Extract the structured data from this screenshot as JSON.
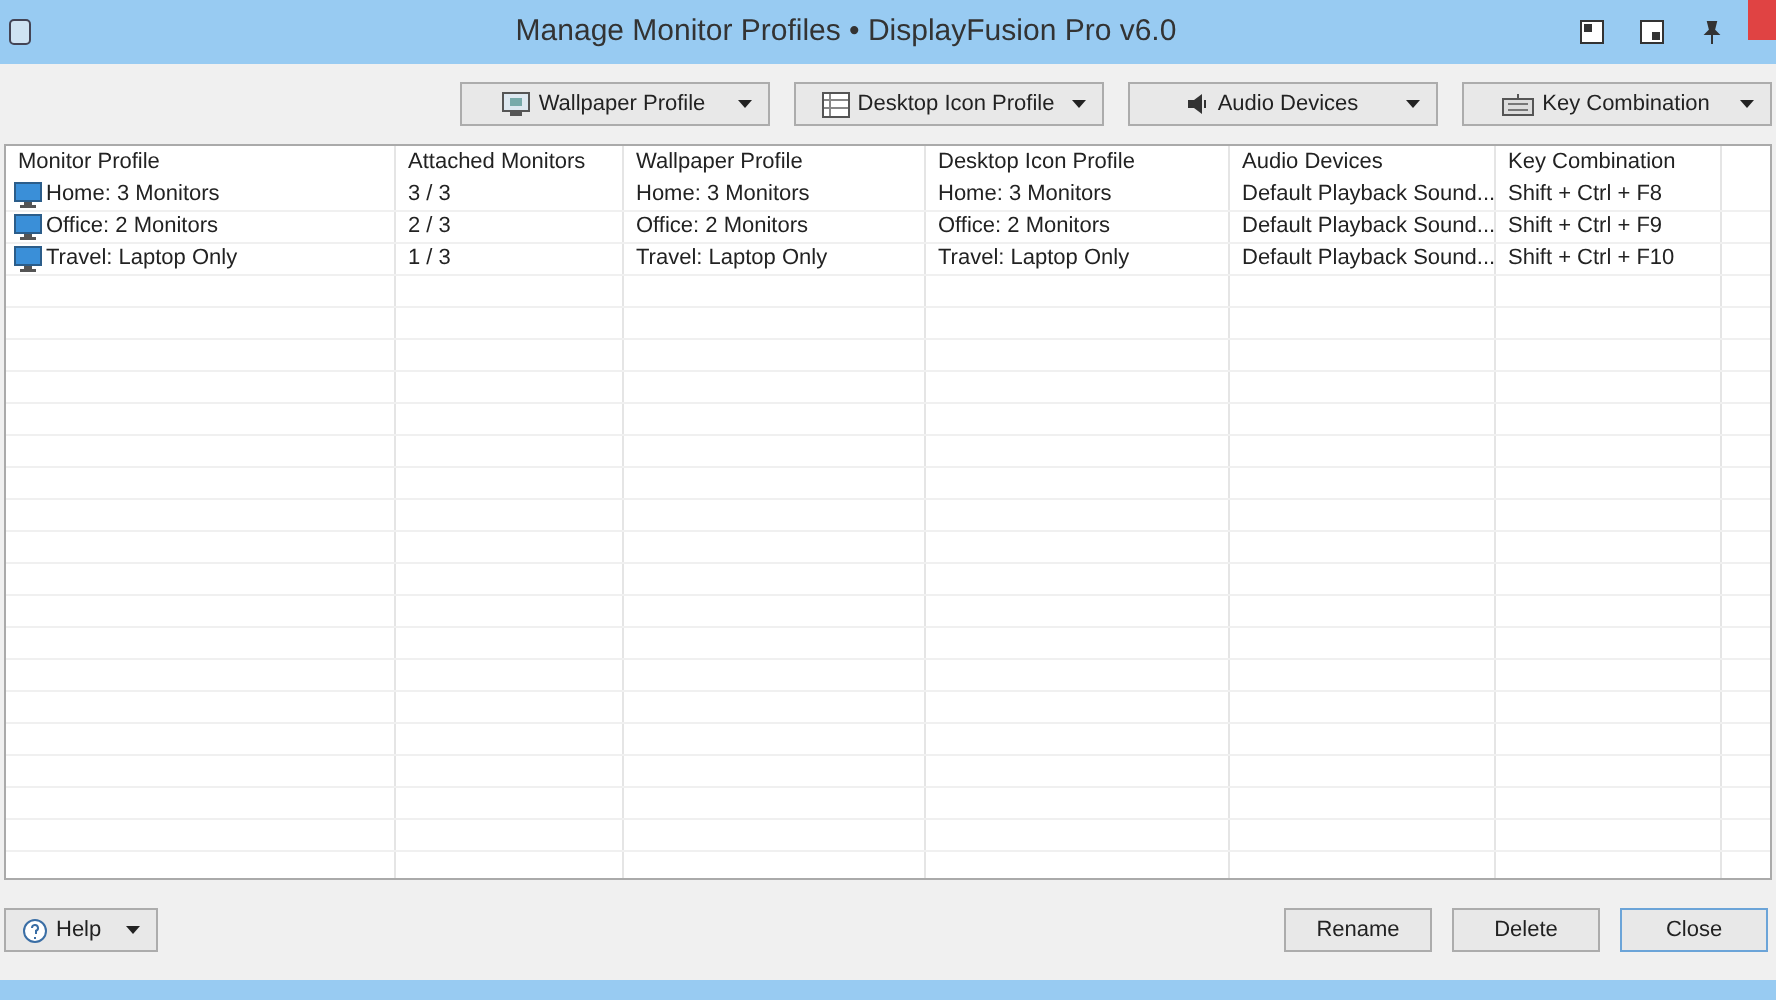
{
  "window": {
    "title": "Manage Monitor Profiles • DisplayFusion Pro v6.0"
  },
  "toolbar": [
    {
      "label": "Wallpaper Profile",
      "kind": "wallpaper"
    },
    {
      "label": "Desktop Icon Profile",
      "kind": "desktop"
    },
    {
      "label": "Audio Devices",
      "kind": "audio"
    },
    {
      "label": "Key Combination",
      "kind": "keyboard"
    }
  ],
  "table": {
    "columns": [
      "Monitor Profile",
      "Attached Monitors",
      "Wallpaper Profile",
      "Desktop Icon Profile",
      "Audio Devices",
      "Key Combination"
    ],
    "rows": [
      [
        "Home: 3 Monitors",
        "3 / 3",
        "Home: 3 Monitors",
        "Home: 3 Monitors",
        "Default Playback Sound...",
        "Shift + Ctrl + F8"
      ],
      [
        "Office: 2 Monitors",
        "2 / 3",
        "Office: 2 Monitors",
        "Office: 2 Monitors",
        "Default Playback Sound...",
        "Shift + Ctrl + F9"
      ],
      [
        "Travel: Laptop Only",
        "1 / 3",
        "Travel: Laptop Only",
        "Travel: Laptop Only",
        "Default Playback Sound...",
        "Shift + Ctrl + F10"
      ]
    ]
  },
  "footer": {
    "help": "Help",
    "buttons": [
      "Rename",
      "Delete",
      "Close"
    ]
  }
}
